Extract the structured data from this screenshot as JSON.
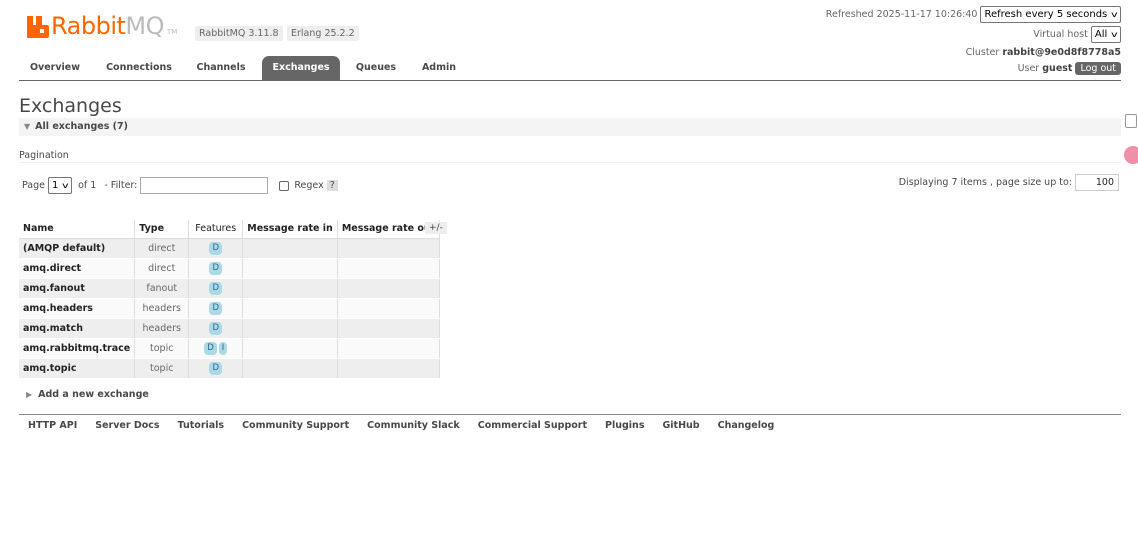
{
  "logo": {
    "brand_primary": "Rabbit",
    "brand_secondary": "MQ",
    "tm": "TM"
  },
  "versions": {
    "rabbitmq": "RabbitMQ 3.11.8",
    "erlang": "Erlang 25.2.2"
  },
  "status": {
    "refreshed": "Refreshed 2025-11-17 10:26:40",
    "refresh_select": "Refresh every 5 seconds",
    "vhost_label": "Virtual host",
    "vhost_value": "All",
    "cluster_label": "Cluster",
    "cluster_value": "rabbit@9e0d8f8778a5",
    "user_label": "User",
    "user_value": "guest",
    "logout": "Log out"
  },
  "tabs": [
    {
      "label": "Overview"
    },
    {
      "label": "Connections"
    },
    {
      "label": "Channels"
    },
    {
      "label": "Exchanges",
      "active": true
    },
    {
      "label": "Queues"
    },
    {
      "label": "Admin"
    }
  ],
  "page": {
    "title": "Exchanges",
    "section": "All exchanges (7)",
    "pagination_label": "Pagination",
    "page_label": "Page",
    "page_value": "1",
    "of_label": "of 1",
    "filter_label": "- Filter:",
    "filter_value": "",
    "regex_label": "Regex",
    "help": "?",
    "displaying": "Displaying 7 items , page size up to:",
    "page_size": "100"
  },
  "table": {
    "headers": {
      "name": "Name",
      "type": "Type",
      "features": "Features",
      "rate_in": "Message rate in",
      "rate_out": "Message rate out"
    },
    "toggle": "+/-",
    "rows": [
      {
        "name": "(AMQP default)",
        "type": "direct",
        "features": [
          "D"
        ]
      },
      {
        "name": "amq.direct",
        "type": "direct",
        "features": [
          "D"
        ]
      },
      {
        "name": "amq.fanout",
        "type": "fanout",
        "features": [
          "D"
        ]
      },
      {
        "name": "amq.headers",
        "type": "headers",
        "features": [
          "D"
        ]
      },
      {
        "name": "amq.match",
        "type": "headers",
        "features": [
          "D"
        ]
      },
      {
        "name": "amq.rabbitmq.trace",
        "type": "topic",
        "features": [
          "D",
          "I"
        ]
      },
      {
        "name": "amq.topic",
        "type": "topic",
        "features": [
          "D"
        ]
      }
    ]
  },
  "add_exchange": "Add a new exchange",
  "footer": [
    "HTTP API",
    "Server Docs",
    "Tutorials",
    "Community Support",
    "Community Slack",
    "Commercial Support",
    "Plugins",
    "GitHub",
    "Changelog"
  ],
  "colors": {
    "brand": "#ff6600",
    "tab_active": "#666666",
    "feature_tag": "#add8e6"
  },
  "icons": {
    "side_1": "app-grid-icon",
    "side_2": "assistant-bubble-icon"
  }
}
